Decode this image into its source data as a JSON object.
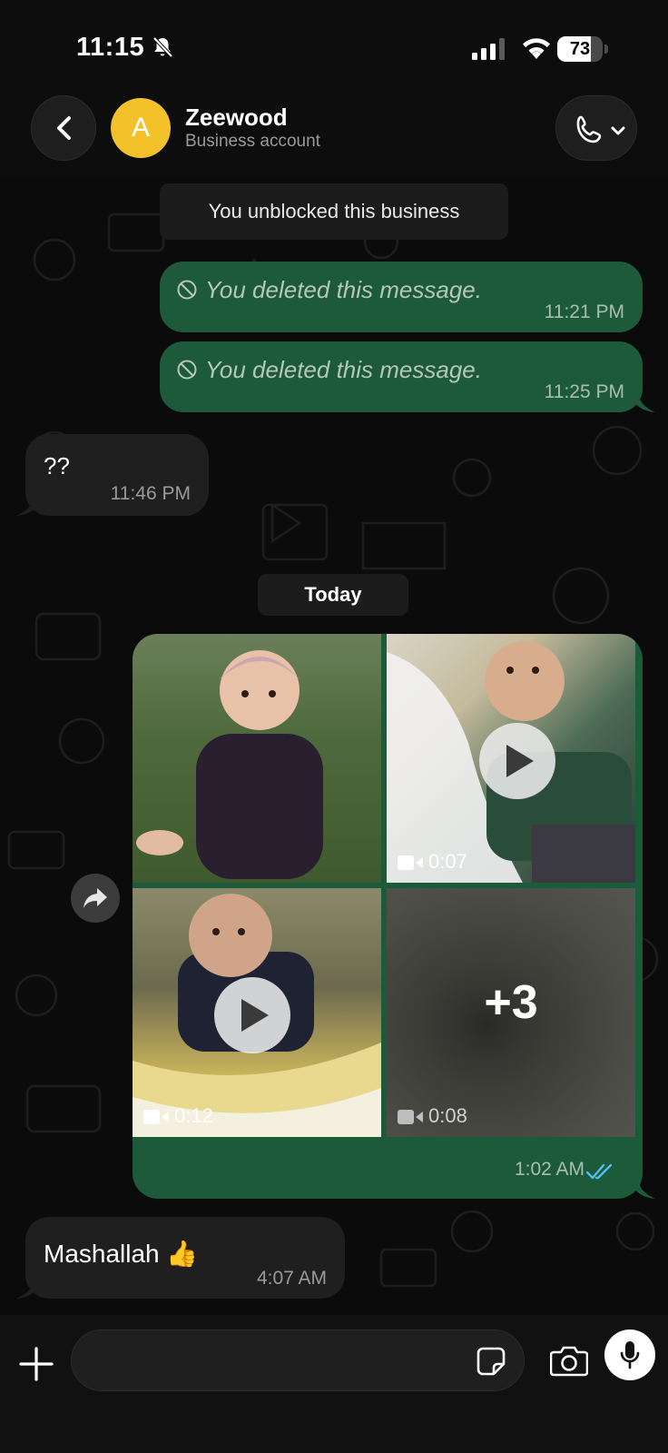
{
  "status_bar": {
    "time": "11:15",
    "battery": "73",
    "battery_level": 0.73
  },
  "header": {
    "avatar_letter": "A",
    "contact_name": "Zeewood",
    "contact_subtitle": "Business account",
    "back_icon": "chevron-left-icon",
    "call_icon": "phone-icon"
  },
  "chat": {
    "system_message": "You unblocked this business",
    "messages": [
      {
        "direction": "out",
        "text": "You deleted this message.",
        "time": "11:21 PM",
        "deleted": true
      },
      {
        "direction": "out",
        "text": "You deleted this message.",
        "time": "11:25 PM",
        "deleted": true
      },
      {
        "direction": "in",
        "text": "??",
        "time": "11:46 PM"
      }
    ],
    "date_chip": "Today",
    "media_message": {
      "direction": "out",
      "time": "1:02 AM",
      "read_status": "double-check-icon",
      "tiles": [
        {
          "kind": "photo"
        },
        {
          "kind": "video",
          "duration": "0:07"
        },
        {
          "kind": "video",
          "duration": "0:12"
        },
        {
          "kind": "video",
          "duration": "0:08",
          "more_count": "+3"
        }
      ]
    },
    "last_message": {
      "direction": "in",
      "text": "Mashallah 👍",
      "time": "4:07 AM"
    }
  },
  "input_bar": {
    "placeholder": "",
    "value": ""
  },
  "colors": {
    "outgoing_bubble": "#1d5a3a",
    "incoming_bubble": "#1f1f1f",
    "avatar": "#f3c22b",
    "read_ticks": "#53bdeb"
  }
}
